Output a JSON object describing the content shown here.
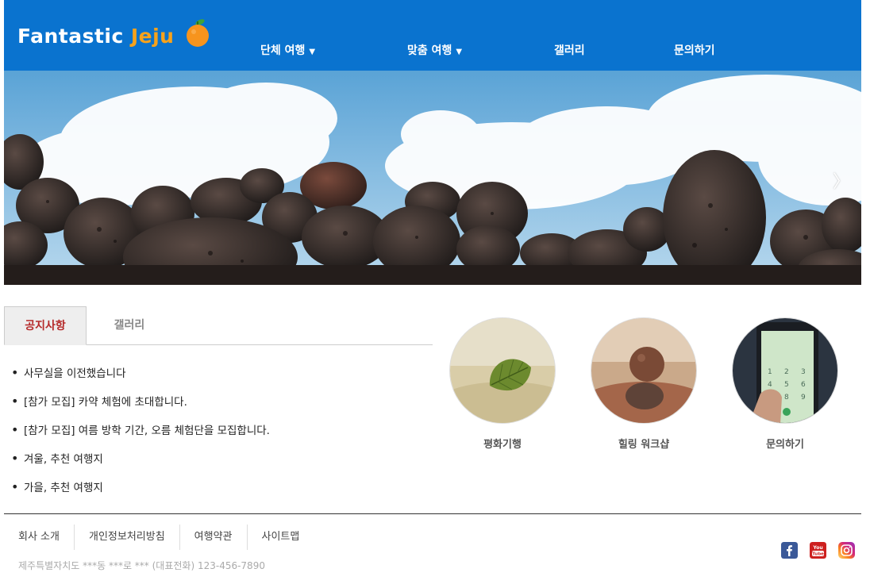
{
  "header": {
    "logo_part1": "Fantastic",
    "logo_part2": "Jeju",
    "nav": [
      {
        "label": "단체 여행",
        "has_dropdown": true
      },
      {
        "label": "맞춤 여행",
        "has_dropdown": true
      },
      {
        "label": "갤러리",
        "has_dropdown": false
      },
      {
        "label": "문의하기",
        "has_dropdown": false
      }
    ],
    "caret": "▼"
  },
  "hero": {
    "next_arrow": "〉"
  },
  "tabs": {
    "active": "공지사항",
    "inactive": "갤러리"
  },
  "notices": [
    "사무실을 이전했습니다",
    "[참가 모집] 카약 체험에 초대합니다.",
    "[참가 모집] 여름 방학 기간, 오름 체험단을 모집합니다.",
    "겨울, 추천 여행지",
    "가을, 추천 여행지"
  ],
  "features": [
    {
      "label": "평화기행",
      "icon": "leaf-on-sand"
    },
    {
      "label": "힐링 워크샵",
      "icon": "stacked-stones"
    },
    {
      "label": "문의하기",
      "icon": "phone-dialpad"
    }
  ],
  "footer": {
    "links": [
      "회사 소개",
      "개인정보처리방침",
      "여행약관",
      "사이트맵"
    ],
    "address": "제주특별자치도 ***동 ***로 *** (대표전화) 123-456-7890",
    "social": [
      "facebook-icon",
      "youtube-icon",
      "instagram-icon"
    ]
  },
  "colors": {
    "header_bg": "#0a73cf",
    "logo_accent": "#f7a21b",
    "active_tab_text": "#b52a2a"
  }
}
